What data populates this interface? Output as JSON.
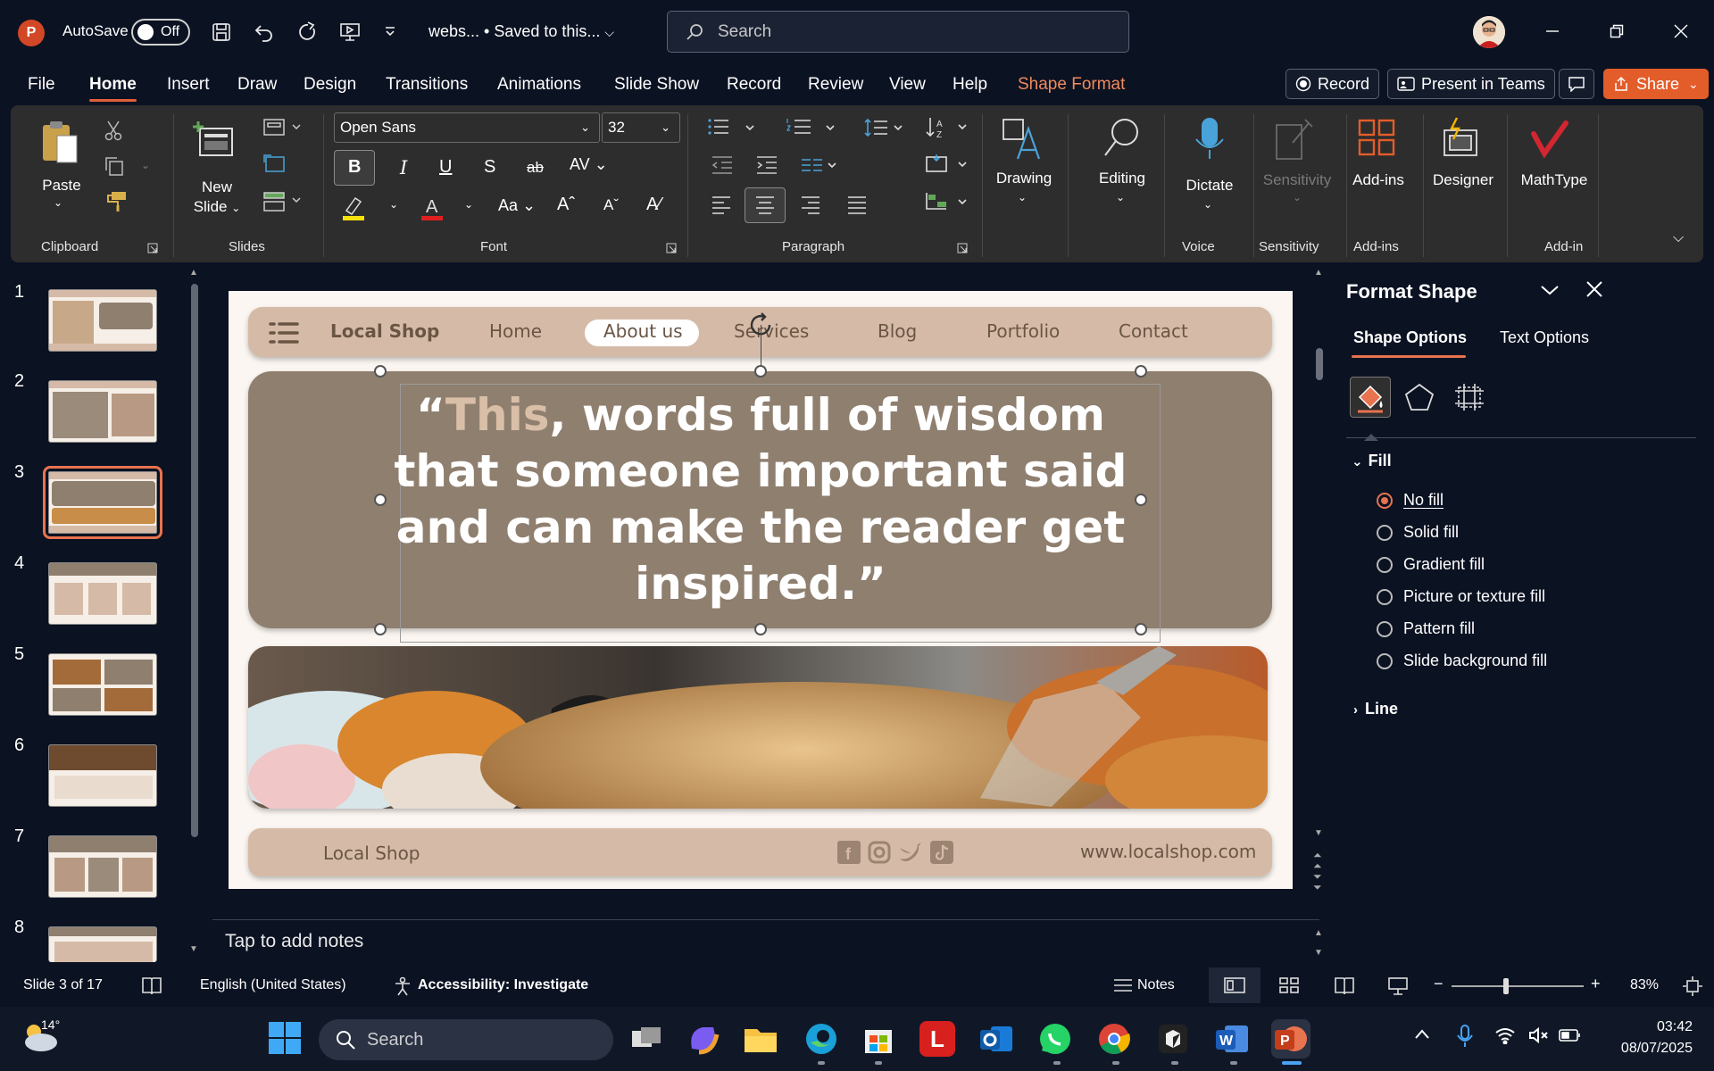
{
  "titlebar": {
    "app_logo": "P",
    "autosave_label": "AutoSave",
    "autosave_state": "Off",
    "doc_title": "webs... • Saved to this...",
    "search_placeholder": "Search"
  },
  "menu": {
    "tabs": [
      "File",
      "Home",
      "Insert",
      "Draw",
      "Design",
      "Transitions",
      "Animations",
      "Slide Show",
      "Record",
      "Review",
      "View",
      "Help",
      "Shape Format"
    ],
    "active_tab": "Home",
    "record_button": "Record",
    "present_button": "Present in Teams",
    "share_button": "Share"
  },
  "ribbon": {
    "paste": "Paste",
    "new_slide_line1": "New",
    "new_slide_line2": "Slide",
    "font_name": "Open Sans",
    "font_size": "32",
    "drawing": "Drawing",
    "editing": "Editing",
    "dictate": "Dictate",
    "sensitivity": "Sensitivity",
    "addins": "Add-ins",
    "designer": "Designer",
    "mathtype": "MathType",
    "groups": {
      "clipboard": "Clipboard",
      "slides": "Slides",
      "font": "Font",
      "paragraph": "Paragraph",
      "voice": "Voice",
      "sensitivity": "Sensitivity",
      "addins": "Add-ins",
      "addin": "Add-in"
    }
  },
  "thumbnails": {
    "numbers": [
      "1",
      "2",
      "3",
      "4",
      "5",
      "6",
      "7",
      "8"
    ],
    "selected": 3
  },
  "slide": {
    "nav": {
      "brand": "Local Shop",
      "items": [
        "Home",
        "About us",
        "Services",
        "Blog",
        "Portfolio",
        "Contact"
      ]
    },
    "quote_highlight": "This",
    "quote_open": "“",
    "quote_rest": ", words full of wisdom that someone important said and can make the reader get inspired.”",
    "footer_brand": "Local Shop",
    "footer_url": "www.localshop.com"
  },
  "notes_placeholder": "Tap to add notes",
  "format_pane": {
    "title": "Format Shape",
    "tab_shape": "Shape Options",
    "tab_text": "Text Options",
    "fill_header": "Fill",
    "fill_options": [
      "No fill",
      "Solid fill",
      "Gradient fill",
      "Picture or texture fill",
      "Pattern fill",
      "Slide background fill"
    ],
    "selected_fill": "No fill",
    "line_header": "Line"
  },
  "statusbar": {
    "slide_info": "Slide 3 of 17",
    "language": "English (United States)",
    "accessibility": "Accessibility: Investigate",
    "notes": "Notes",
    "zoom_minus": "−",
    "zoom_plus": "+",
    "zoom": "83%"
  },
  "taskbar": {
    "weather": "14°",
    "search": "Search",
    "time": "03:42",
    "date": "08/07/2025"
  },
  "colors": {
    "accent": "#e8734f",
    "ribbon_bg": "#2d2d2d",
    "app_bg": "#0b1222",
    "slide_tan": "#d5bba7",
    "slide_brown": "#8f7f6f"
  }
}
